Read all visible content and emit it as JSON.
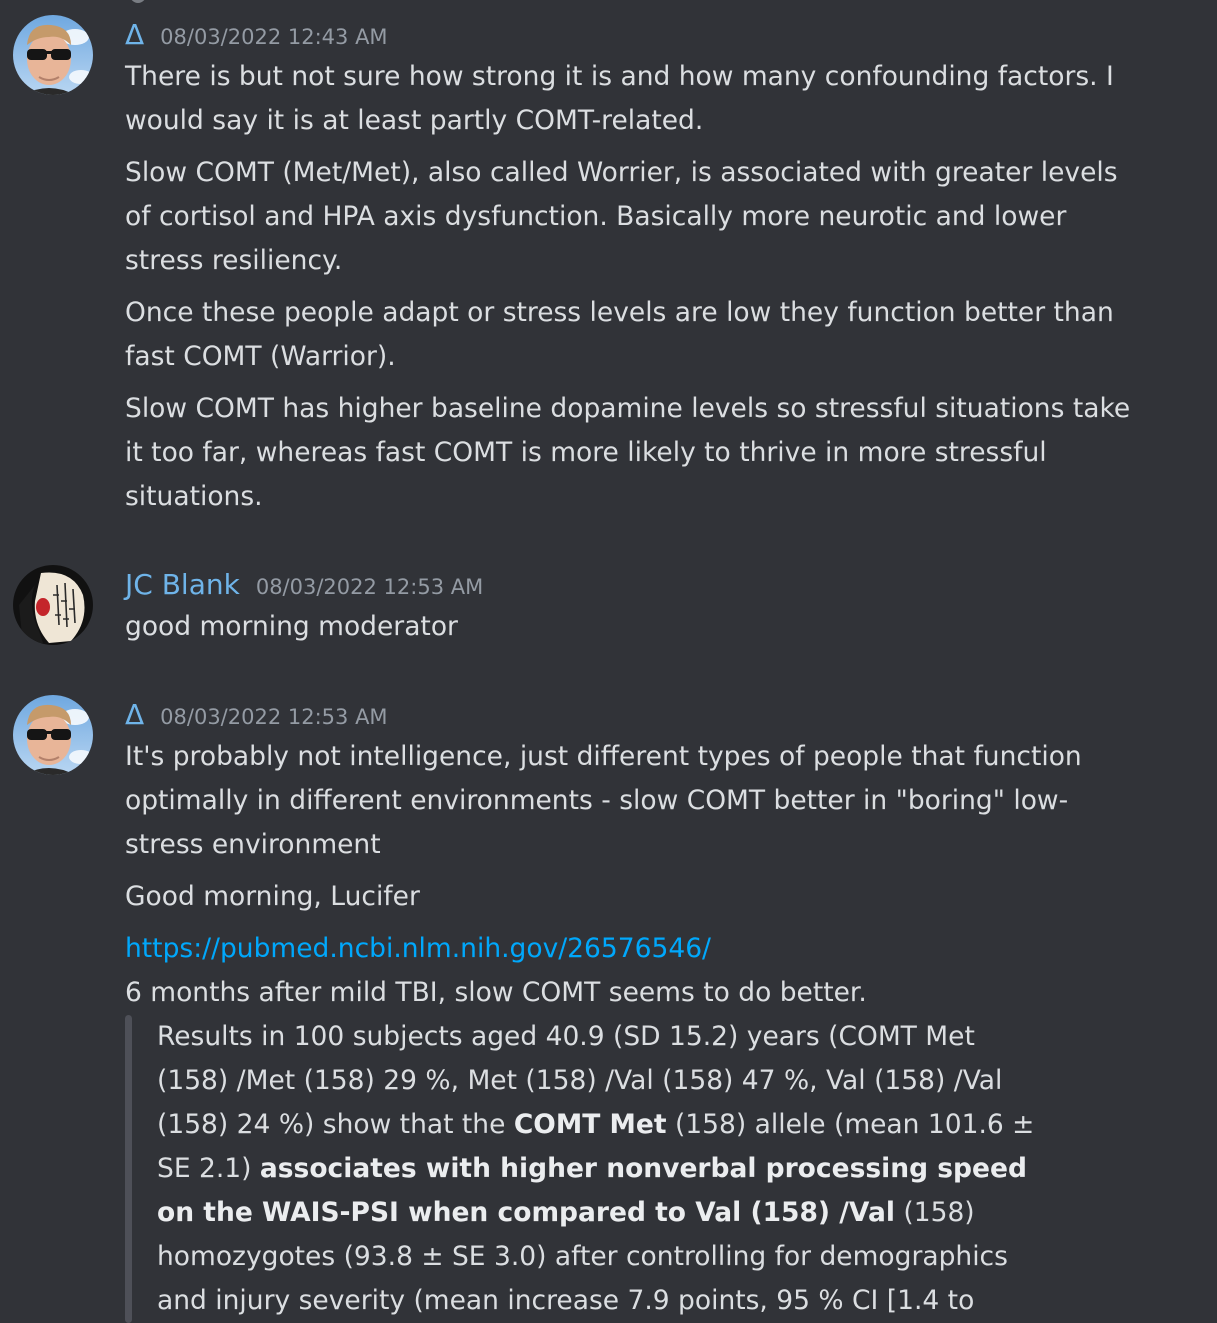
{
  "messages": [
    {
      "author": "Δ",
      "timestamp": "08/03/2022 12:43 AM",
      "paragraphs": [
        "There is but not sure how strong it is and how many confounding factors. I would say it is at least partly COMT-related.",
        "Slow COMT (Met/Met), also called Worrier, is associated with greater levels of cortisol and HPA axis dysfunction. Basically more neurotic and lower stress resiliency.",
        "Once these people adapt or stress levels are low they function better than fast COMT (Warrior).",
        "Slow COMT has higher baseline dopamine levels so stressful situations take it too far, whereas fast COMT is more likely to thrive in more stressful situations."
      ]
    },
    {
      "author": "JC Blank",
      "timestamp": "08/03/2022 12:53 AM",
      "paragraphs": [
        "good morning moderator"
      ]
    },
    {
      "author": "Δ",
      "timestamp": "08/03/2022 12:53 AM",
      "paragraphs": [
        "It's probably not intelligence, just different types of people that function optimally in different environments - slow COMT better in \"boring\" low-stress environment",
        "Good morning, Lucifer"
      ],
      "link": "https://pubmed.ncbi.nlm.nih.gov/26576546/",
      "after_link": "6 months after mild TBI, slow COMT seems to do better.",
      "quote": {
        "t1": "Results in 100 subjects aged 40.9 (SD 15.2) years (COMT Met (158) /Met (158) 29 %, Met (158) /Val (158) 47 %, Val (158) /Val (158) 24 %) show that the ",
        "b1": "COMT Met",
        "t2": " (158) allele (mean 101.6 ± SE 2.1) ",
        "b2": "associates with higher nonverbal processing speed on the WAIS-PSI when compared to Val (158) /Val",
        "t3": " (158) homozygotes (93.8 ± SE 3.0) after controlling for demographics and injury severity (mean increase 7.9 points, 95 % CI [1.4 to"
      }
    }
  ],
  "colors": {
    "background": "#313338",
    "username": "#6fb4e9",
    "link": "#00a8fc",
    "text": "#dbdee1",
    "timestamp": "#949ba4",
    "quote_bar": "#4e5058"
  },
  "icons": {
    "avatar_delta": "avatar-sunglasses-man",
    "avatar_jc": "avatar-illustrated-figure"
  }
}
